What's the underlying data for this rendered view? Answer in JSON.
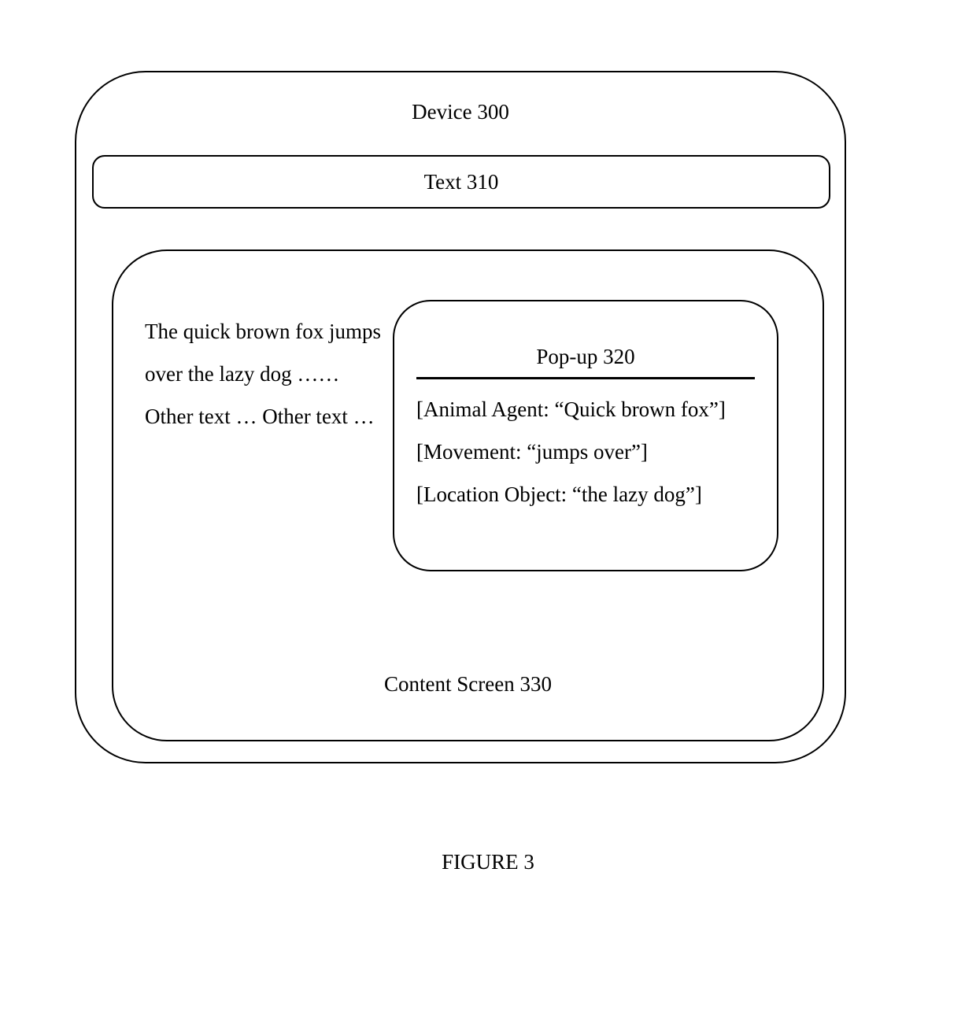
{
  "device": {
    "label": "Device 300",
    "text_bar_label": "Text 310"
  },
  "content_screen": {
    "label": "Content Screen 330",
    "display_text_line1": "The quick brown fox jumps",
    "display_text_line2": "over the lazy dog ……",
    "display_text_line3": "Other text … Other text …"
  },
  "popup": {
    "title": "Pop-up 320",
    "line1": "[Animal Agent: “Quick brown fox”]",
    "line2": "[Movement: “jumps over”]",
    "line3": "[Location Object: “the lazy dog”]"
  },
  "figure_caption": "FIGURE 3"
}
